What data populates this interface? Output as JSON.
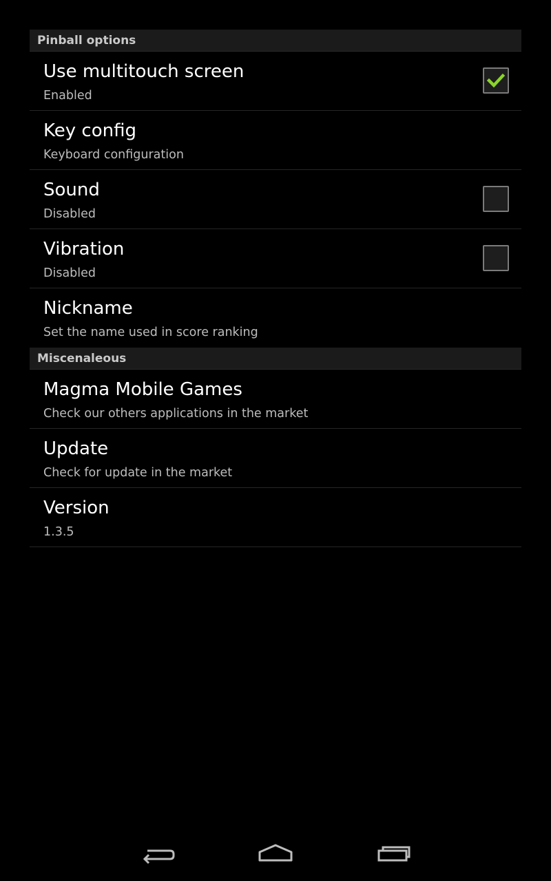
{
  "sections": {
    "pinball": {
      "header": "Pinball options",
      "multitouch": {
        "title": "Use multitouch screen",
        "summary": "Enabled",
        "checked": true
      },
      "key_config": {
        "title": "Key config",
        "summary": "Keyboard configuration"
      },
      "sound": {
        "title": "Sound",
        "summary": "Disabled",
        "checked": false
      },
      "vibration": {
        "title": "Vibration",
        "summary": "Disabled",
        "checked": false
      },
      "nickname": {
        "title": "Nickname",
        "summary": "Set the name used in score ranking"
      }
    },
    "misc": {
      "header": "Miscenaleous",
      "magma": {
        "title": "Magma Mobile Games",
        "summary": "Check our others applications in the market"
      },
      "update": {
        "title": "Update",
        "summary": "Check for update in the market"
      },
      "version": {
        "title": "Version",
        "summary": "1.3.5"
      }
    }
  },
  "navbar": {
    "back_icon": "back-icon",
    "home_icon": "home-icon",
    "recents_icon": "recents-icon"
  },
  "colors": {
    "background": "#000000",
    "check_accent": "#8ad52a",
    "header_bg": "#1b1b1b"
  }
}
